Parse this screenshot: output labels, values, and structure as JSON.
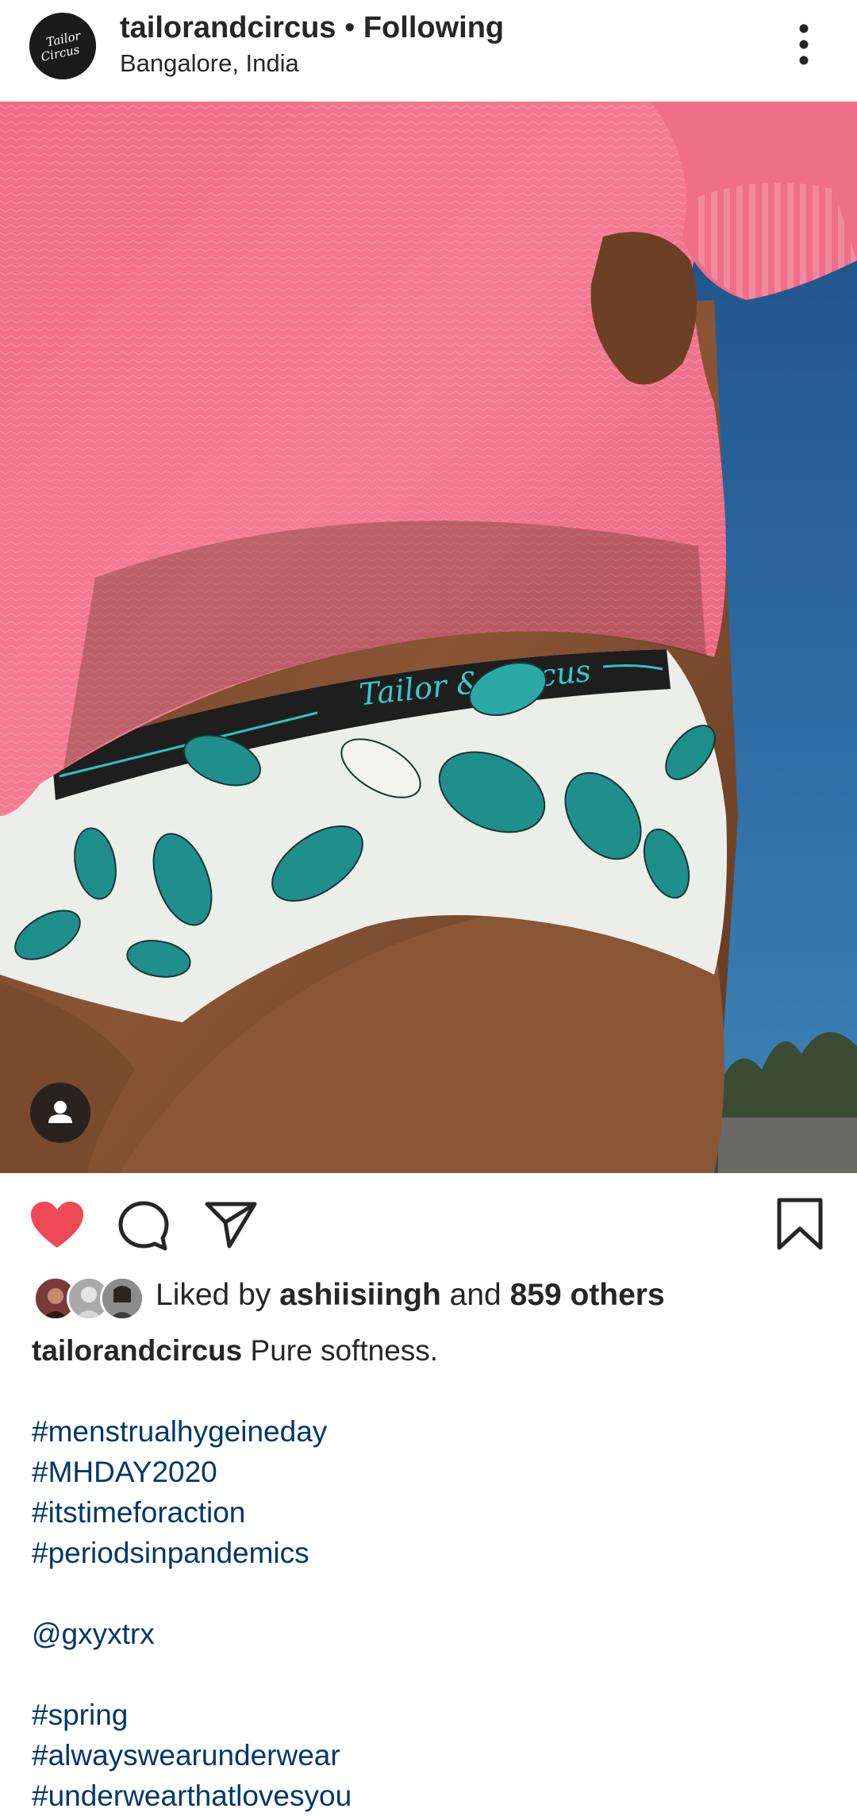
{
  "header": {
    "username": "tailorandcircus",
    "separator": " • ",
    "follow_status": "Following",
    "location": "Bangalore, India",
    "avatar_text_1": "Tailor",
    "avatar_text_2": "Circus"
  },
  "post": {
    "waistband_text": "Tailor & Circus"
  },
  "actions": {
    "liked": true,
    "like_color": "#ed4956"
  },
  "likes": {
    "prefix": "Liked by ",
    "first_liker": "ashiisiingh",
    "middle": " and ",
    "others": "859 others"
  },
  "caption": {
    "username": "tailorandcircus",
    "text": "Pure softness.",
    "hashtags_1": [
      "#menstrualhygeineday",
      "#MHDAY2020",
      "#itstimeforaction",
      "#periodsinpandemics"
    ],
    "mention": "@gxyxtrx",
    "hashtags_2": [
      "#spring",
      "#alwayswearunderwear",
      "#underwearthatlovesyou"
    ]
  },
  "colors": {
    "link": "#00376b",
    "text": "#262626",
    "like": "#ed4956"
  }
}
